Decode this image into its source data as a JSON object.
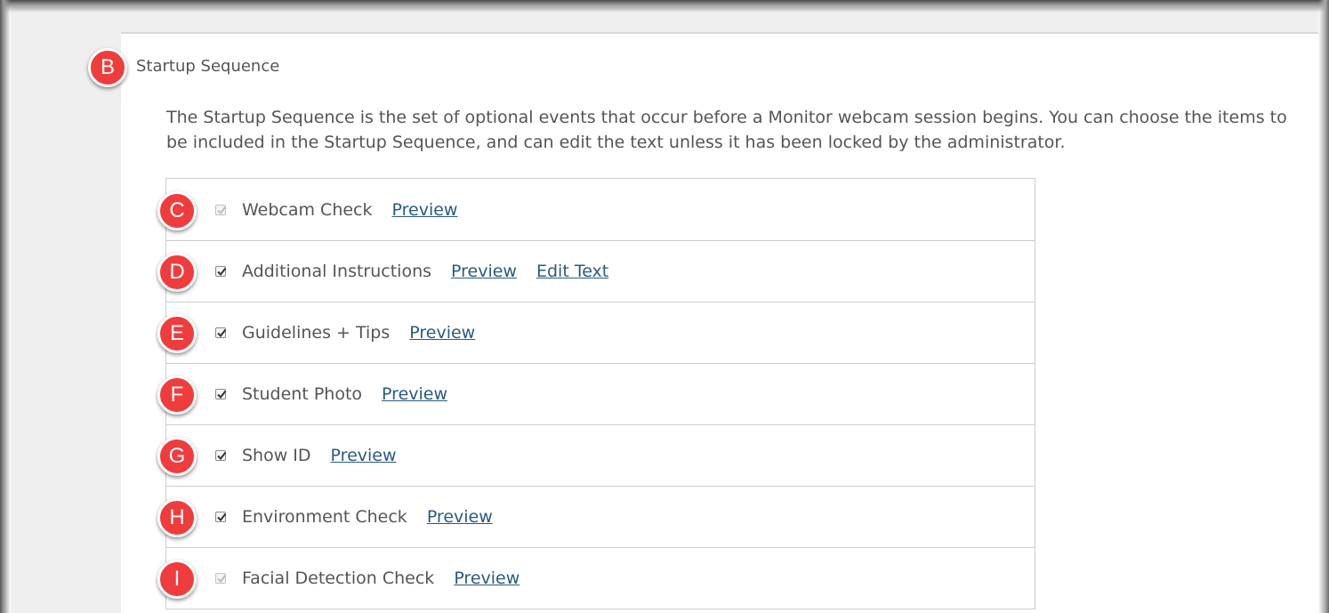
{
  "badges": {
    "section": "B",
    "items": [
      "C",
      "D",
      "E",
      "F",
      "G",
      "H",
      "I"
    ]
  },
  "section": {
    "title": "Startup Sequence",
    "description": "The Startup Sequence is the set of optional events that occur before a Monitor webcam session begins. You can choose the items to be included in the Startup Sequence, and can edit the text unless it has been locked by the administrator."
  },
  "items": [
    {
      "label": "Webcam Check",
      "checked": true,
      "disabled": true,
      "links": [
        "Preview"
      ]
    },
    {
      "label": "Additional Instructions",
      "checked": true,
      "disabled": false,
      "links": [
        "Preview",
        "Edit Text"
      ]
    },
    {
      "label": "Guidelines + Tips",
      "checked": true,
      "disabled": false,
      "links": [
        "Preview"
      ]
    },
    {
      "label": "Student Photo",
      "checked": true,
      "disabled": false,
      "links": [
        "Preview"
      ]
    },
    {
      "label": "Show ID",
      "checked": true,
      "disabled": false,
      "links": [
        "Preview"
      ]
    },
    {
      "label": "Environment Check",
      "checked": true,
      "disabled": false,
      "links": [
        "Preview"
      ]
    },
    {
      "label": "Facial Detection Check",
      "checked": true,
      "disabled": true,
      "links": [
        "Preview"
      ]
    }
  ],
  "colors": {
    "badge": "#f03c3c",
    "link": "#2a5a82",
    "text": "#555555",
    "sidebar": "#efefef"
  },
  "icons": {
    "check": "checkmark-icon"
  }
}
